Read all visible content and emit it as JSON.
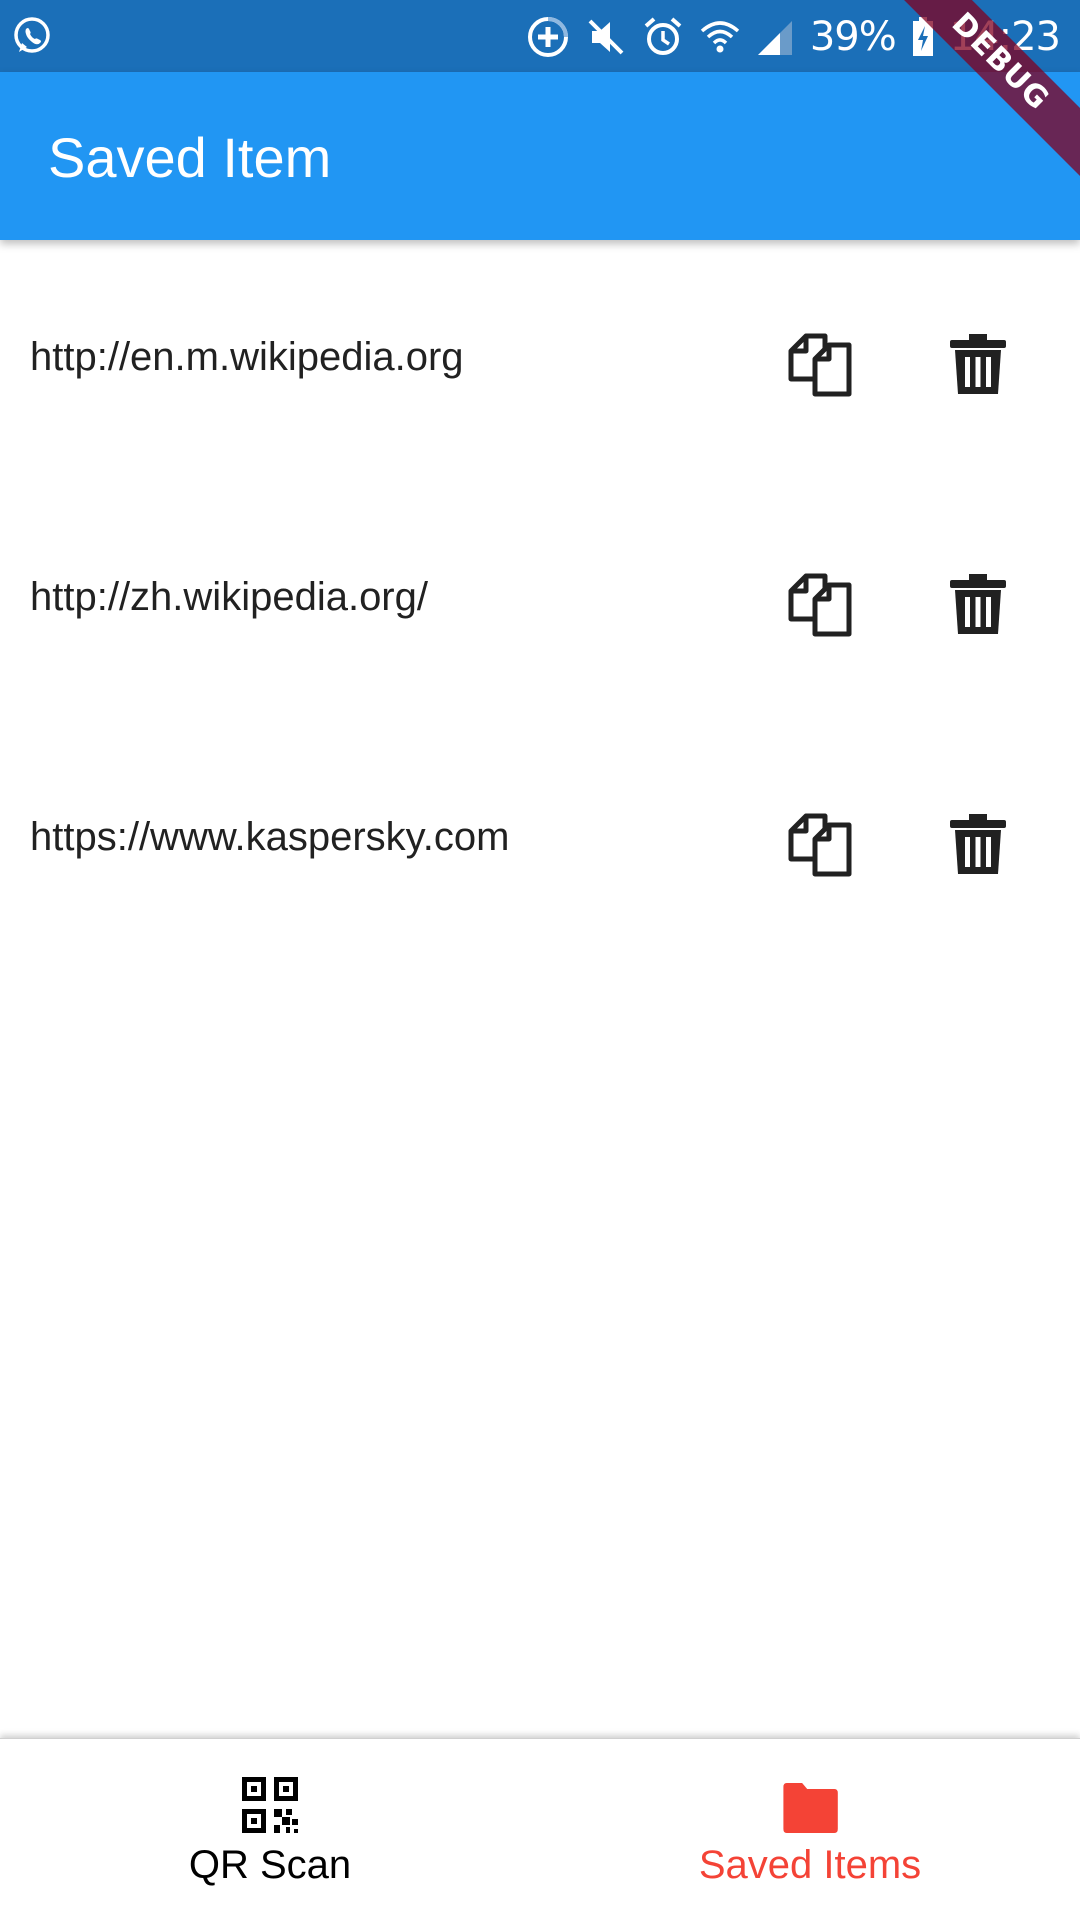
{
  "status_bar": {
    "battery": "39%",
    "time": "14:23",
    "icons": [
      "whatsapp-icon",
      "data-saver-icon",
      "mute-icon",
      "alarm-icon",
      "wifi-icon",
      "signal-icon",
      "battery-charging-icon"
    ]
  },
  "debug_banner": "DEBUG",
  "app_bar": {
    "title": "Saved Item"
  },
  "items": [
    {
      "url": "http://en.m.wikipedia.org"
    },
    {
      "url": "http://zh.wikipedia.org/"
    },
    {
      "url": "https://www.kaspersky.com"
    }
  ],
  "item_actions": {
    "copy_icon": "copy-icon",
    "delete_icon": "delete-icon"
  },
  "bottom_nav": {
    "tabs": [
      {
        "label": "QR Scan",
        "icon": "qr-code-icon",
        "active": false
      },
      {
        "label": "Saved Items",
        "icon": "folder-icon",
        "active": true
      }
    ]
  },
  "colors": {
    "status_bar": "#1b6fb8",
    "app_bar": "#2196f3",
    "active_tab": "#f44336",
    "inactive_tab": "#000000",
    "text": "#212121"
  }
}
